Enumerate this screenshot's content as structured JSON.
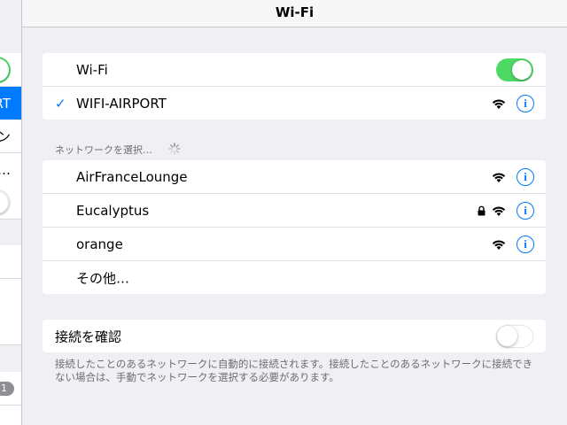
{
  "navbar": {
    "title": "Wi-Fi"
  },
  "left_pane": {
    "selected_fragment": "RPORT",
    "fragment_1": "ン",
    "fragment_2": "…",
    "badge": "1"
  },
  "wifi_group": {
    "wifi_label": "Wi-Fi",
    "wifi_toggle": "on",
    "connected_check": "✓",
    "connected_network": "WIFI-AIRPORT"
  },
  "networks": {
    "header": "ネットワークを選択…",
    "items": [
      {
        "name": "AirFranceLounge",
        "secured": false
      },
      {
        "name": "Eucalyptus",
        "secured": true
      },
      {
        "name": "orange",
        "secured": false
      }
    ],
    "other_label": "その他…"
  },
  "ask_join": {
    "label": "接続を確認",
    "toggle": "off",
    "note": "接続したことのあるネットワークに自動的に接続されます。接続したことのあるネットワークに接続できない場合は、手動でネットワークを選択する必要があります。"
  },
  "icons": {
    "info": "i",
    "wifi": "wifi-icon",
    "lock": "lock-icon",
    "spinner": "spinner-icon"
  },
  "colors": {
    "accent": "#007aff",
    "toggle_on": "#4cd964",
    "background": "#efeff4"
  }
}
